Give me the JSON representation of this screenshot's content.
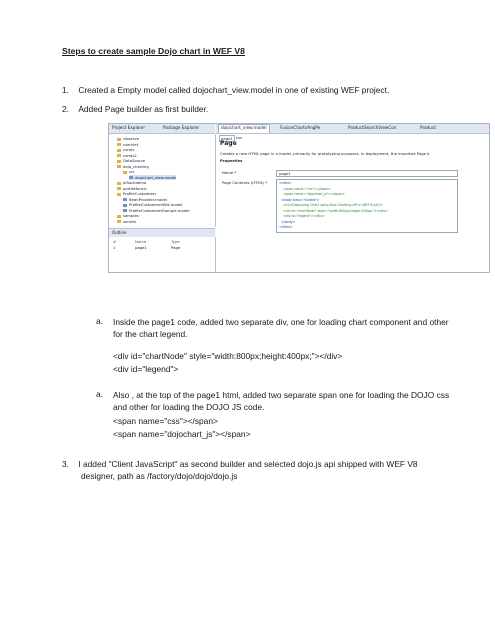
{
  "document": {
    "title": "Steps to create sample Dojo chart in WEF V8",
    "steps": [
      {
        "number": "1.",
        "text": "Created a Empty model called dojochart_view.model in one of existing WEF project."
      },
      {
        "number": "2.",
        "text": "Added Page builder as first builder."
      },
      {
        "number": "3.",
        "line1": "I added \"Client JavaScript\" as second builder and selected dojo.js api shipped with WEF V8",
        "line2": "designer, path as /factory/dojo/dojo/dojo.js"
      }
    ],
    "substeps": [
      {
        "marker": "a.",
        "line1": "Inside the page1 code, added two separate div, one for loading chart component and other",
        "line2": "for the chart legend.",
        "code": [
          "<div id=\"chartNode\" style=\"width:800px;height:400px;\"></div>",
          "<div id=\"legend\">"
        ]
      },
      {
        "marker": "a.",
        "line1": "Also , at the top of the page1 html, added two separate span one for loading the DOJO css",
        "line2": "and other for loading the DOJO JS code.",
        "code": [
          "<span name=\"css\"></span>",
          "<span name=\"dojochart_js\"></span>"
        ]
      }
    ]
  },
  "screenshot": {
    "left_tabs": [
      "Project Explorer",
      "Package Explorer"
    ],
    "tree": [
      "cibserve",
      "cservlet",
      "corejs",
      "corejs2",
      "DataSource",
      "dojo_charting",
      "src",
      "dojochart_view.model",
      "piSockdemo",
      "portletforms",
      "ProfileCustomizer",
      "BeanProvider.model",
      "ProfileCustomizerWid.model",
      "ProfileCustomizerSample.model",
      "samples",
      "servlet"
    ],
    "outline_header": "Outline",
    "outline_cols": [
      "#",
      "Name",
      "Type"
    ],
    "outline_row": [
      "1",
      "page1",
      "Page"
    ],
    "right_tabs": [
      "dojochart_view.model",
      "FusionChartsAngPe",
      "ProductSearchViewCon",
      "Product"
    ],
    "editor_subtabs": [
      "page1",
      "css"
    ],
    "editor_heading": "Page",
    "editor_desc": "Creates a new HTML page in a model, primarily for prototyping purposes. In deployment, the imported Page b",
    "properties_label": "Properties",
    "name_label": "Name *",
    "name_value": "page1",
    "contents_label": "Page Contents (HTML) *",
    "code_lines": [
      "<html>",
      "<span name=\"css\"></span>",
      "<span name=\"dojochart_js\"></span>",
      "<body class=\"tundra\">",
      "<h2>Displaying Chart using Dojo Charting API in WEF 8</h2>",
      "<div id=\"chartNode\" style=\"width:800px;height:400px;\"></div>",
      "<div id=\"legend\"></div>",
      "</body>",
      "</html>"
    ]
  }
}
